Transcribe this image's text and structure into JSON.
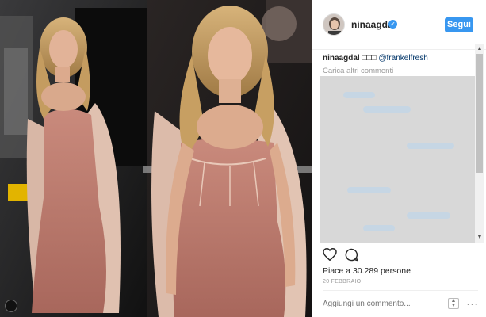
{
  "post": {
    "username": "ninaagdal",
    "verified_glyph": "✓",
    "follow_label": "Segui",
    "caption_user": "ninaagdal",
    "caption_emoji": "□□□",
    "caption_mention": "@frankelfresh",
    "load_more": "Carica altri commenti",
    "likes": "Piace a 30.289 persone",
    "date": "20 FEBBRAIO",
    "comment_placeholder": "Aggiungi un commento...",
    "more_glyph": "···"
  },
  "icons": {
    "heart": "heart-icon",
    "comment": "comment-icon",
    "more": "more-options-icon",
    "verified": "verified-badge-icon"
  },
  "colors": {
    "accent": "#3897f0",
    "text": "#262626",
    "muted": "#999999"
  }
}
